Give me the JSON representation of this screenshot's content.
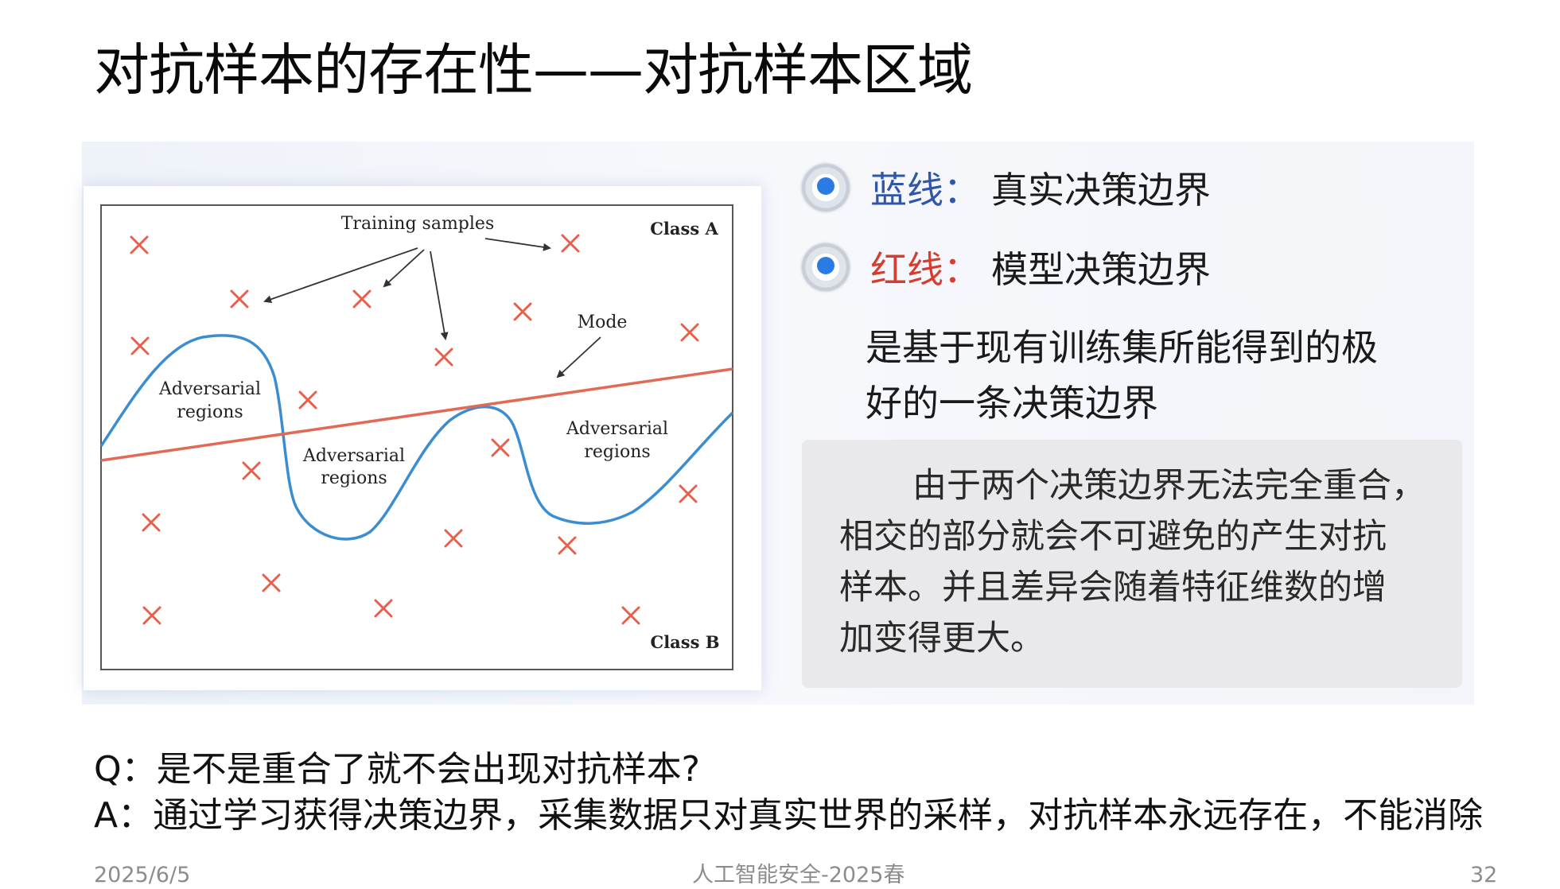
{
  "title": "对抗样本的存在性——对抗样本区域",
  "figure": {
    "training_samples_label": "Training samples",
    "class_a_label": "Class A",
    "class_b_label": "Class B",
    "mode_label": "Mode",
    "adv_region_1": [
      "Adversarial",
      "regions"
    ],
    "adv_region_2": [
      "Adversarial",
      "regions"
    ],
    "adv_region_3": [
      "Adversarial",
      "regions"
    ],
    "colors": {
      "blue_line": "#3c8dd0",
      "red_line": "#e06a55",
      "markers": "#e8604c"
    }
  },
  "bullets": [
    {
      "key": "蓝线：",
      "value": "真实决策边界",
      "color": "#2f56a8"
    },
    {
      "key": "红线：",
      "value": "模型决策边界",
      "color": "#d43d2f"
    }
  ],
  "description": [
    "是基于现有训练集所能得到的极",
    "好的一条决策边界"
  ],
  "note": [
    "由于两个决策边界无法完全重合，",
    "相交的部分就会不可避免的产生对抗",
    "样本。并且差异会随着特征维数的增",
    "加变得更大。"
  ],
  "question": "Q：是不是重合了就不会出现对抗样本?",
  "answer": "A：通过学习获得决策边界，采集数据只对真实世界的采样，对抗样本永远存在，不能消除",
  "footer": {
    "date": "2025/6/5",
    "course": "人工智能安全-2025春",
    "page": "32"
  }
}
